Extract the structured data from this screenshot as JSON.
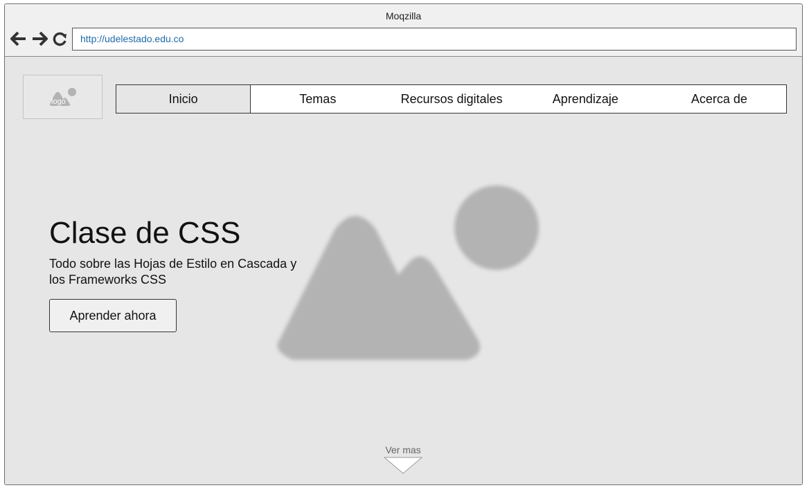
{
  "browser": {
    "title": "Moqzilla",
    "url": "http://udelestado.edu.co"
  },
  "logo": {
    "label": "logo"
  },
  "nav": {
    "items": [
      {
        "label": "Inicio",
        "active": true
      },
      {
        "label": "Temas"
      },
      {
        "label": "Recursos digitales"
      },
      {
        "label": "Aprendizaje"
      },
      {
        "label": "Acerca de"
      }
    ]
  },
  "hero": {
    "title": "Clase de CSS",
    "subtitle": "Todo sobre las Hojas de Estilo en Cascada y los Frameworks CSS",
    "button_label": "Aprender ahora"
  },
  "footer": {
    "more_label": "Ver mas"
  },
  "colors": {
    "page_bg": "#e6e6e6",
    "placeholder_gray": "#b3b3b3",
    "link_blue": "#1f6aa8"
  },
  "icons": [
    "back-arrow-icon",
    "forward-arrow-icon",
    "reload-icon",
    "image-placeholder-icon",
    "chevron-down-icon"
  ]
}
